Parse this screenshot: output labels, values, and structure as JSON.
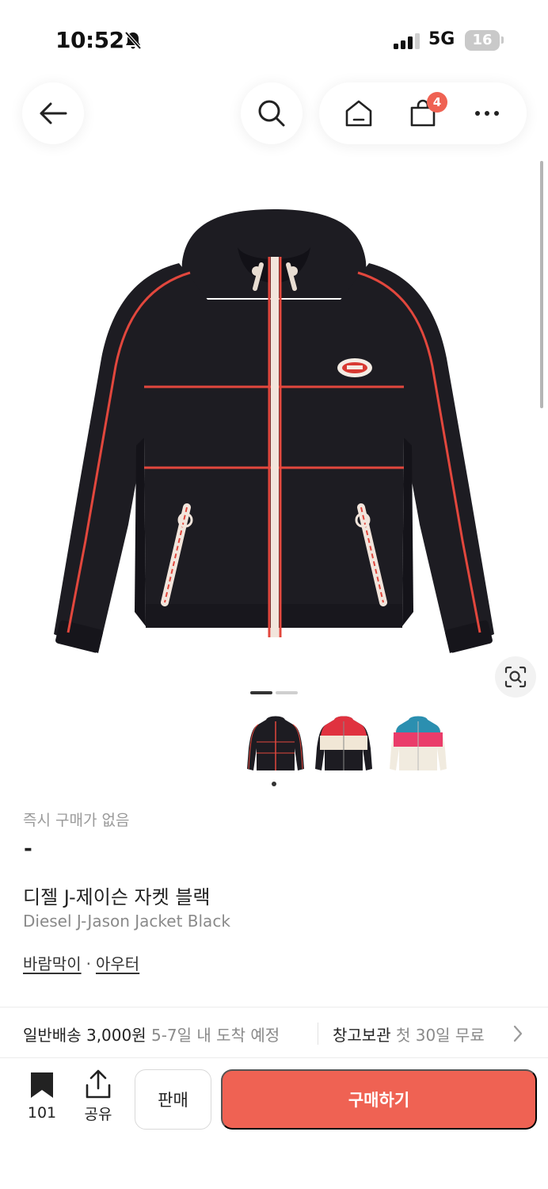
{
  "status_bar": {
    "time": "10:52",
    "network": "5G",
    "battery": "16"
  },
  "header": {
    "cart_count": "4"
  },
  "colors": {
    "accent": "#ef6253",
    "jacket": "#1d1c22",
    "trim": "#e2473d"
  },
  "icons": [
    "back-arrow-icon",
    "search-icon",
    "home-icon",
    "shopping-bag-icon",
    "more-icon",
    "lens-search-icon",
    "bookmark-icon",
    "share-icon",
    "chevron-right-icon",
    "bell-slash-icon"
  ],
  "product": {
    "instant_purchase_label": "즉시 구매가 없음",
    "price": "-",
    "name_ko": "디젤 J-제이슨 자켓 블랙",
    "name_en": "Diesel J-Jason Jacket Black",
    "categories": [
      "바람막이",
      "아우터"
    ],
    "category_separator": "·"
  },
  "gallery": {
    "pages": 2,
    "current_page": 1,
    "thumbnails": [
      "black-red",
      "red-cream-black",
      "teal-pink-cream"
    ],
    "selected_thumbnail": 1
  },
  "shipping": {
    "standard_label": "일반배송",
    "standard_price": "3,000원",
    "standard_eta": "5-7일 내 도착 예정",
    "storage_label": "창고보관",
    "storage_offer": "첫 30일 무료"
  },
  "bottom_bar": {
    "wish_count": "101",
    "share_label": "공유",
    "sell_label": "판매",
    "buy_label": "구매하기"
  }
}
